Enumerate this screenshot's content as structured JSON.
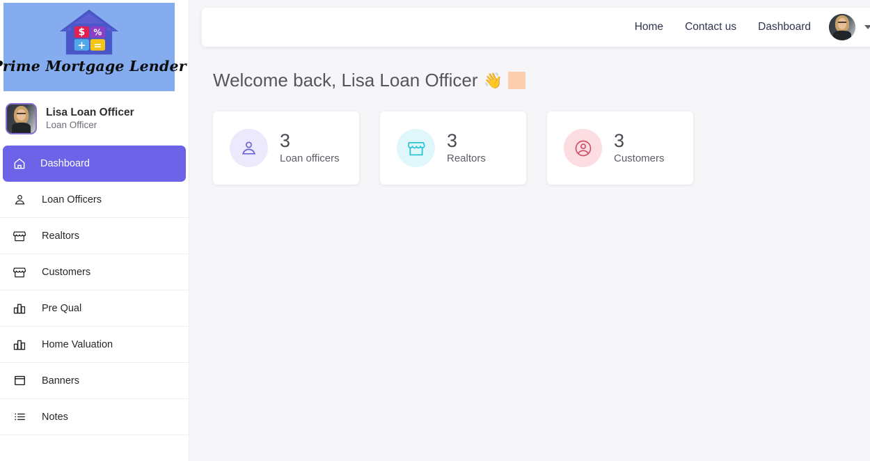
{
  "sidebar": {
    "logo": {
      "brand_text": "Prime Mortgage Lender",
      "icon": "house-calculator-logo",
      "bg_color": "#84acee",
      "keys": [
        "$",
        "%",
        "+",
        "="
      ]
    },
    "profile": {
      "avatar": "user-avatar",
      "name": "Lisa Loan Officer",
      "role": "Loan Officer"
    },
    "active_color": "#6c63e8",
    "items": [
      {
        "label": "Dashboard",
        "icon": "home-icon",
        "active": true
      },
      {
        "label": "Loan Officers",
        "icon": "person-icon",
        "active": false
      },
      {
        "label": "Realtors",
        "icon": "storefront-icon",
        "active": false
      },
      {
        "label": "Customers",
        "icon": "storefront-icon",
        "active": false
      },
      {
        "label": "Pre Qual",
        "icon": "bar-chart-icon",
        "active": false
      },
      {
        "label": "Home Valuation",
        "icon": "bar-chart-icon",
        "active": false
      },
      {
        "label": "Banners",
        "icon": "window-icon",
        "active": false
      },
      {
        "label": "Notes",
        "icon": "list-icon",
        "active": false
      }
    ]
  },
  "topbar": {
    "links": [
      {
        "label": "Home"
      },
      {
        "label": "Contact us"
      },
      {
        "label": "Dashboard"
      }
    ],
    "avatar": "user-avatar",
    "caret": "chevron-down-icon"
  },
  "main": {
    "welcome_text": "Welcome back, Lisa Loan Officer",
    "wave_emoji": "👋",
    "cards": [
      {
        "count": "3",
        "label": "Loan officers",
        "icon": "person-icon",
        "icon_color": "#6c63d2",
        "icon_bg": "#ebe9fb"
      },
      {
        "count": "3",
        "label": "Realtors",
        "icon": "storefront-icon",
        "icon_color": "#2bc4d6",
        "icon_bg": "#dff7fa"
      },
      {
        "count": "3",
        "label": "Customers",
        "icon": "account-circle-icon",
        "icon_color": "#cf4d63",
        "icon_bg": "#fbdde2"
      }
    ]
  }
}
